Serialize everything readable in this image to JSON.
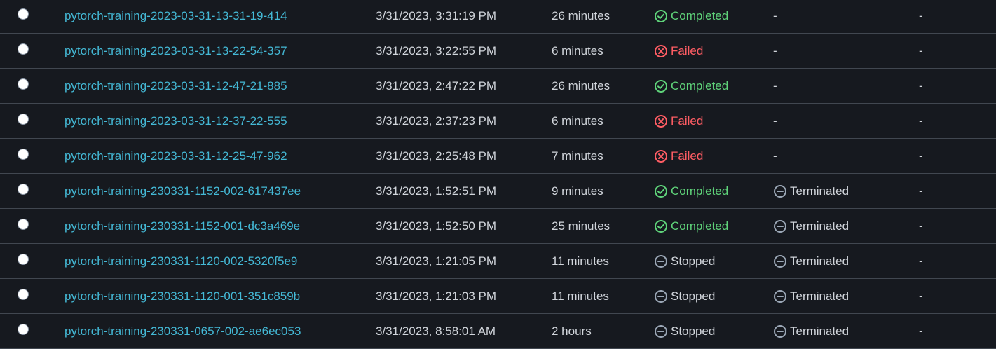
{
  "colors": {
    "background": "#16191f",
    "link": "#44b9d6",
    "text": "#d1d5db",
    "completed": "#5fd37a",
    "failed": "#ff5d64",
    "neutral": "#9ba7b6",
    "divider": "#414750"
  },
  "rows": [
    {
      "name": "pytorch-training-2023-03-31-13-31-19-414",
      "created": "3/31/2023, 3:31:19 PM",
      "duration": "26 minutes",
      "status": "Completed",
      "warm_pool": "-",
      "last": "-"
    },
    {
      "name": "pytorch-training-2023-03-31-13-22-54-357",
      "created": "3/31/2023, 3:22:55 PM",
      "duration": "6 minutes",
      "status": "Failed",
      "warm_pool": "-",
      "last": "-"
    },
    {
      "name": "pytorch-training-2023-03-31-12-47-21-885",
      "created": "3/31/2023, 2:47:22 PM",
      "duration": "26 minutes",
      "status": "Completed",
      "warm_pool": "-",
      "last": "-"
    },
    {
      "name": "pytorch-training-2023-03-31-12-37-22-555",
      "created": "3/31/2023, 2:37:23 PM",
      "duration": "6 minutes",
      "status": "Failed",
      "warm_pool": "-",
      "last": "-"
    },
    {
      "name": "pytorch-training-2023-03-31-12-25-47-962",
      "created": "3/31/2023, 2:25:48 PM",
      "duration": "7 minutes",
      "status": "Failed",
      "warm_pool": "-",
      "last": "-"
    },
    {
      "name": "pytorch-training-230331-1152-002-617437ee",
      "created": "3/31/2023, 1:52:51 PM",
      "duration": "9 minutes",
      "status": "Completed",
      "warm_pool": "Terminated",
      "last": "-"
    },
    {
      "name": "pytorch-training-230331-1152-001-dc3a469e",
      "created": "3/31/2023, 1:52:50 PM",
      "duration": "25 minutes",
      "status": "Completed",
      "warm_pool": "Terminated",
      "last": "-"
    },
    {
      "name": "pytorch-training-230331-1120-002-5320f5e9",
      "created": "3/31/2023, 1:21:05 PM",
      "duration": "11 minutes",
      "status": "Stopped",
      "warm_pool": "Terminated",
      "last": "-"
    },
    {
      "name": "pytorch-training-230331-1120-001-351c859b",
      "created": "3/31/2023, 1:21:03 PM",
      "duration": "11 minutes",
      "status": "Stopped",
      "warm_pool": "Terminated",
      "last": "-"
    },
    {
      "name": "pytorch-training-230331-0657-002-ae6ec053",
      "created": "3/31/2023, 8:58:01 AM",
      "duration": "2 hours",
      "status": "Stopped",
      "warm_pool": "Terminated",
      "last": "-"
    }
  ]
}
